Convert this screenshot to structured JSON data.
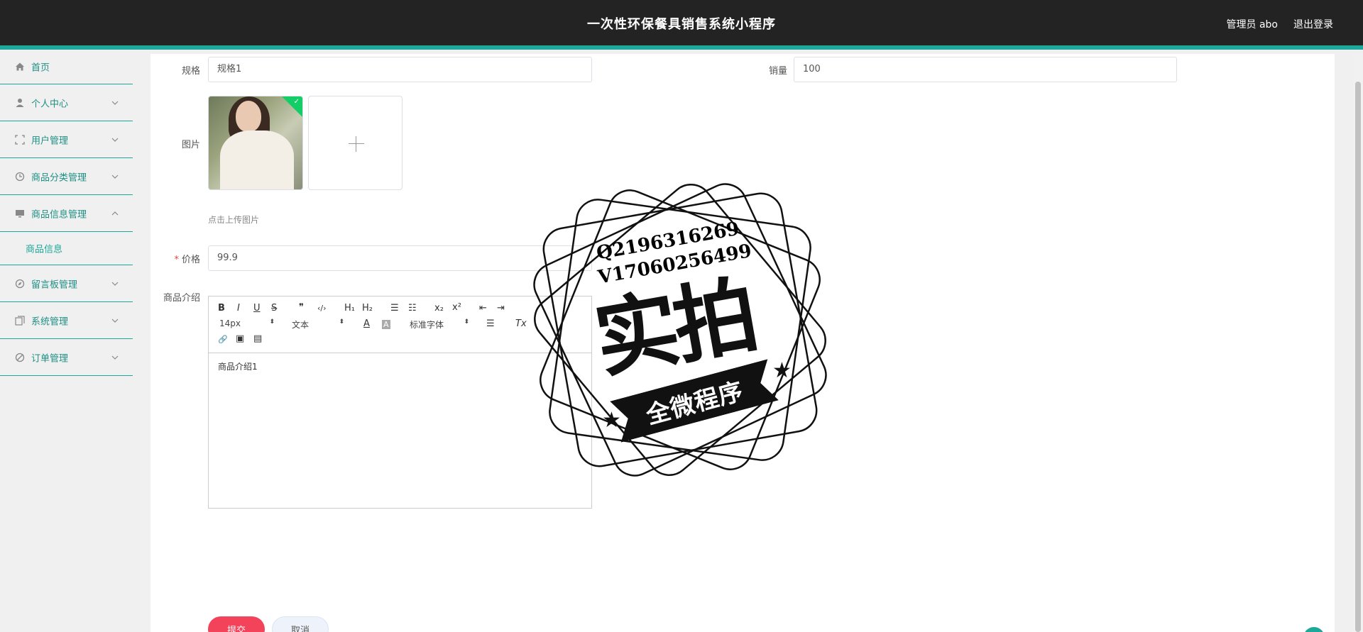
{
  "header": {
    "title": "一次性环保餐具销售系统小程序",
    "user": "管理员 abo",
    "logout": "退出登录"
  },
  "sidebar": {
    "items": [
      {
        "label": "首页",
        "icon": "home-icon"
      },
      {
        "label": "个人中心",
        "icon": "person-icon"
      },
      {
        "label": "用户管理",
        "icon": "fullscreen-icon"
      },
      {
        "label": "商品分类管理",
        "icon": "clock-icon"
      },
      {
        "label": "商品信息管理",
        "icon": "monitor-icon"
      },
      {
        "label": "留言板管理",
        "icon": "compass-icon"
      },
      {
        "label": "系统管理",
        "icon": "copy-icon"
      },
      {
        "label": "订单管理",
        "icon": "sold-out-icon"
      }
    ],
    "sub_item": "商品信息"
  },
  "form": {
    "spec_label": "规格",
    "spec_value": "规格1",
    "sales_label": "销量",
    "sales_value": "100",
    "image_label": "图片",
    "upload_hint": "点击上传图片",
    "price_required": "*",
    "price_label": "价格",
    "price_value": "99.9",
    "intro_label": "商品介绍",
    "intro_content": "商品介绍1"
  },
  "editor": {
    "bold": "B",
    "italic": "I",
    "underline": "U",
    "strike": "S",
    "quote": "❞",
    "code": "‹/›",
    "h1": "H₁",
    "h2": "H₂",
    "ordered_list": "☰",
    "bullet_list": "☷",
    "subscript": "x₂",
    "superscript": "x²",
    "outdent": "⇤",
    "indent": "⇥",
    "size_value": "14px",
    "header_value": "文本",
    "font_value": "标准字体",
    "color": "A",
    "background": "A",
    "align": "☰",
    "clean": "Tx",
    "link": "🔗",
    "image": "▣",
    "video": "▤",
    "accent_color": "#1ea89a"
  },
  "buttons": {
    "submit": "提交",
    "cancel": "取消"
  },
  "stamp": {
    "line1": "Q2196316269",
    "line2": "V17060256499",
    "big": "实拍",
    "ribbon": "全微程序"
  },
  "colors": {
    "header_bg": "#232323",
    "accent": "#1ea89a",
    "submit": "#f2435b"
  }
}
